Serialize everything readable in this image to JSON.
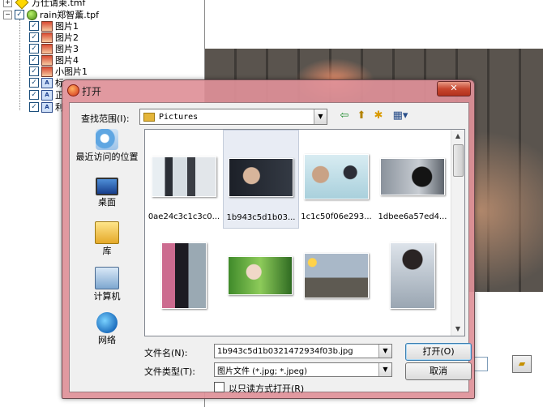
{
  "tree": {
    "items": [
      {
        "label": "万仕请柬.tmf",
        "icon": "yellow-diamond-icon"
      },
      {
        "label": "rain郑智薰.tpf",
        "icon": "green-ball-icon"
      },
      {
        "label": "图片1",
        "icon": "image-layer-icon"
      },
      {
        "label": "图片2",
        "icon": "image-layer-icon"
      },
      {
        "label": "图片3",
        "icon": "image-layer-icon"
      },
      {
        "label": "图片4",
        "icon": "image-layer-icon"
      },
      {
        "label": "小图片1",
        "icon": "image-layer-icon"
      },
      {
        "label": "标",
        "icon": "text-layer-icon"
      },
      {
        "label": "正",
        "icon": "text-layer-icon"
      },
      {
        "label": "利",
        "icon": "text-layer-icon"
      }
    ],
    "expander_collapsed": "+",
    "expander_expanded": "−",
    "check": "✓"
  },
  "dialog": {
    "title": "打开",
    "close_glyph": "✕",
    "lookin_label": "查找范围(I):",
    "lookin_value": "Pictures",
    "toolbar": {
      "back_glyph": "⇦",
      "up_glyph": "⬆",
      "newfolder_glyph": "✱",
      "view_glyph": "▦▾"
    },
    "places": [
      {
        "label": "最近访问的位置",
        "icon": "recent-places-icon"
      },
      {
        "label": "桌面",
        "icon": "desktop-icon"
      },
      {
        "label": "库",
        "icon": "library-icon"
      },
      {
        "label": "计算机",
        "icon": "computer-icon"
      },
      {
        "label": "网络",
        "icon": "network-icon"
      }
    ],
    "files": [
      {
        "name": "0ae24c3c1c3c0...",
        "selected": false
      },
      {
        "name": "1b943c5d1b03...",
        "selected": true
      },
      {
        "name": "1c1c50f06e293...",
        "selected": false
      },
      {
        "name": "1dbee6a57ed4...",
        "selected": false
      },
      {
        "name": "",
        "selected": false
      },
      {
        "name": "",
        "selected": false
      },
      {
        "name": "",
        "selected": false
      },
      {
        "name": "",
        "selected": false
      }
    ],
    "filename_label": "文件名(N):",
    "filename_value": "1b943c5d1b0321472934f03b.jpg",
    "filetype_label": "文件类型(T):",
    "filetype_value": "图片文件 (*.jpg; *.jpeg)",
    "open_button": "打开(O)",
    "cancel_button": "取消",
    "readonly_label": "以只读方式打开(R)",
    "scroll_up": "▲",
    "scroll_down": "▼",
    "combo_arrow": "▼"
  },
  "preview": {
    "folder_glyph": "▰"
  }
}
